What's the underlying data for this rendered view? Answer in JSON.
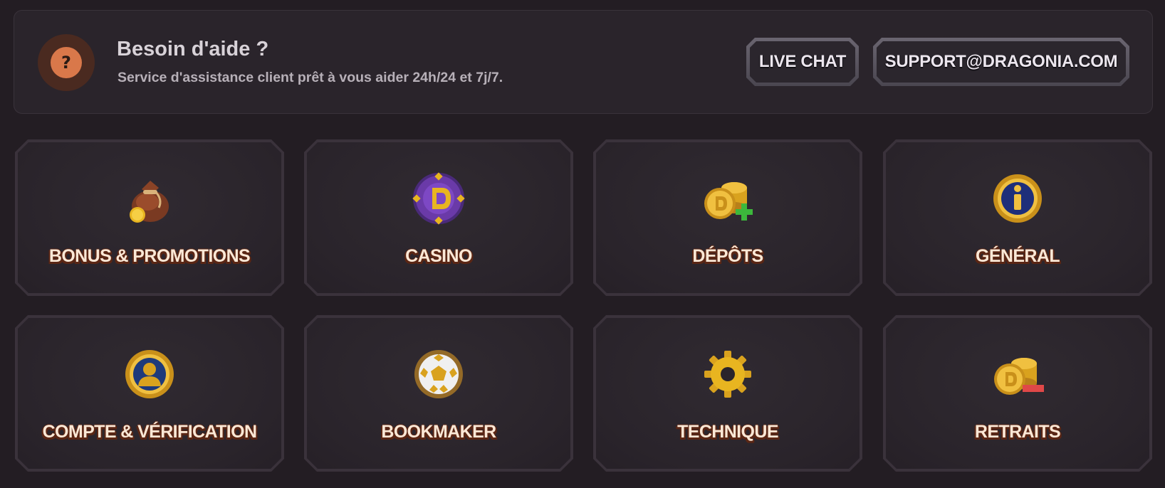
{
  "help": {
    "icon": "question-icon",
    "icon_glyph": "?",
    "title": "Besoin d'aide ?",
    "subtitle": "Service d'assistance client prêt à vous aider 24h/24 et 7j/7.",
    "live_chat_label": "LIVE CHAT",
    "email_label": "SUPPORT@DRAGONIA.COM"
  },
  "categories": [
    {
      "label": "BONUS & PROMOTIONS",
      "icon": "money-bag-icon"
    },
    {
      "label": "CASINO",
      "icon": "casino-chip-icon"
    },
    {
      "label": "DÉPÔTS",
      "icon": "coins-plus-icon"
    },
    {
      "label": "GÉNÉRAL",
      "icon": "info-icon"
    },
    {
      "label": "COMPTE & VÉRIFICATION",
      "icon": "user-account-icon"
    },
    {
      "label": "BOOKMAKER",
      "icon": "football-icon"
    },
    {
      "label": "TECHNIQUE",
      "icon": "gear-icon"
    },
    {
      "label": "RETRAITS",
      "icon": "coins-minus-icon"
    }
  ],
  "colors": {
    "background": "#231d23",
    "card": "#2a242b",
    "accent_orange": "#d9784a",
    "label_text": "#fbe8d6",
    "label_outline": "#5a2614",
    "gold": "#e8b520"
  }
}
